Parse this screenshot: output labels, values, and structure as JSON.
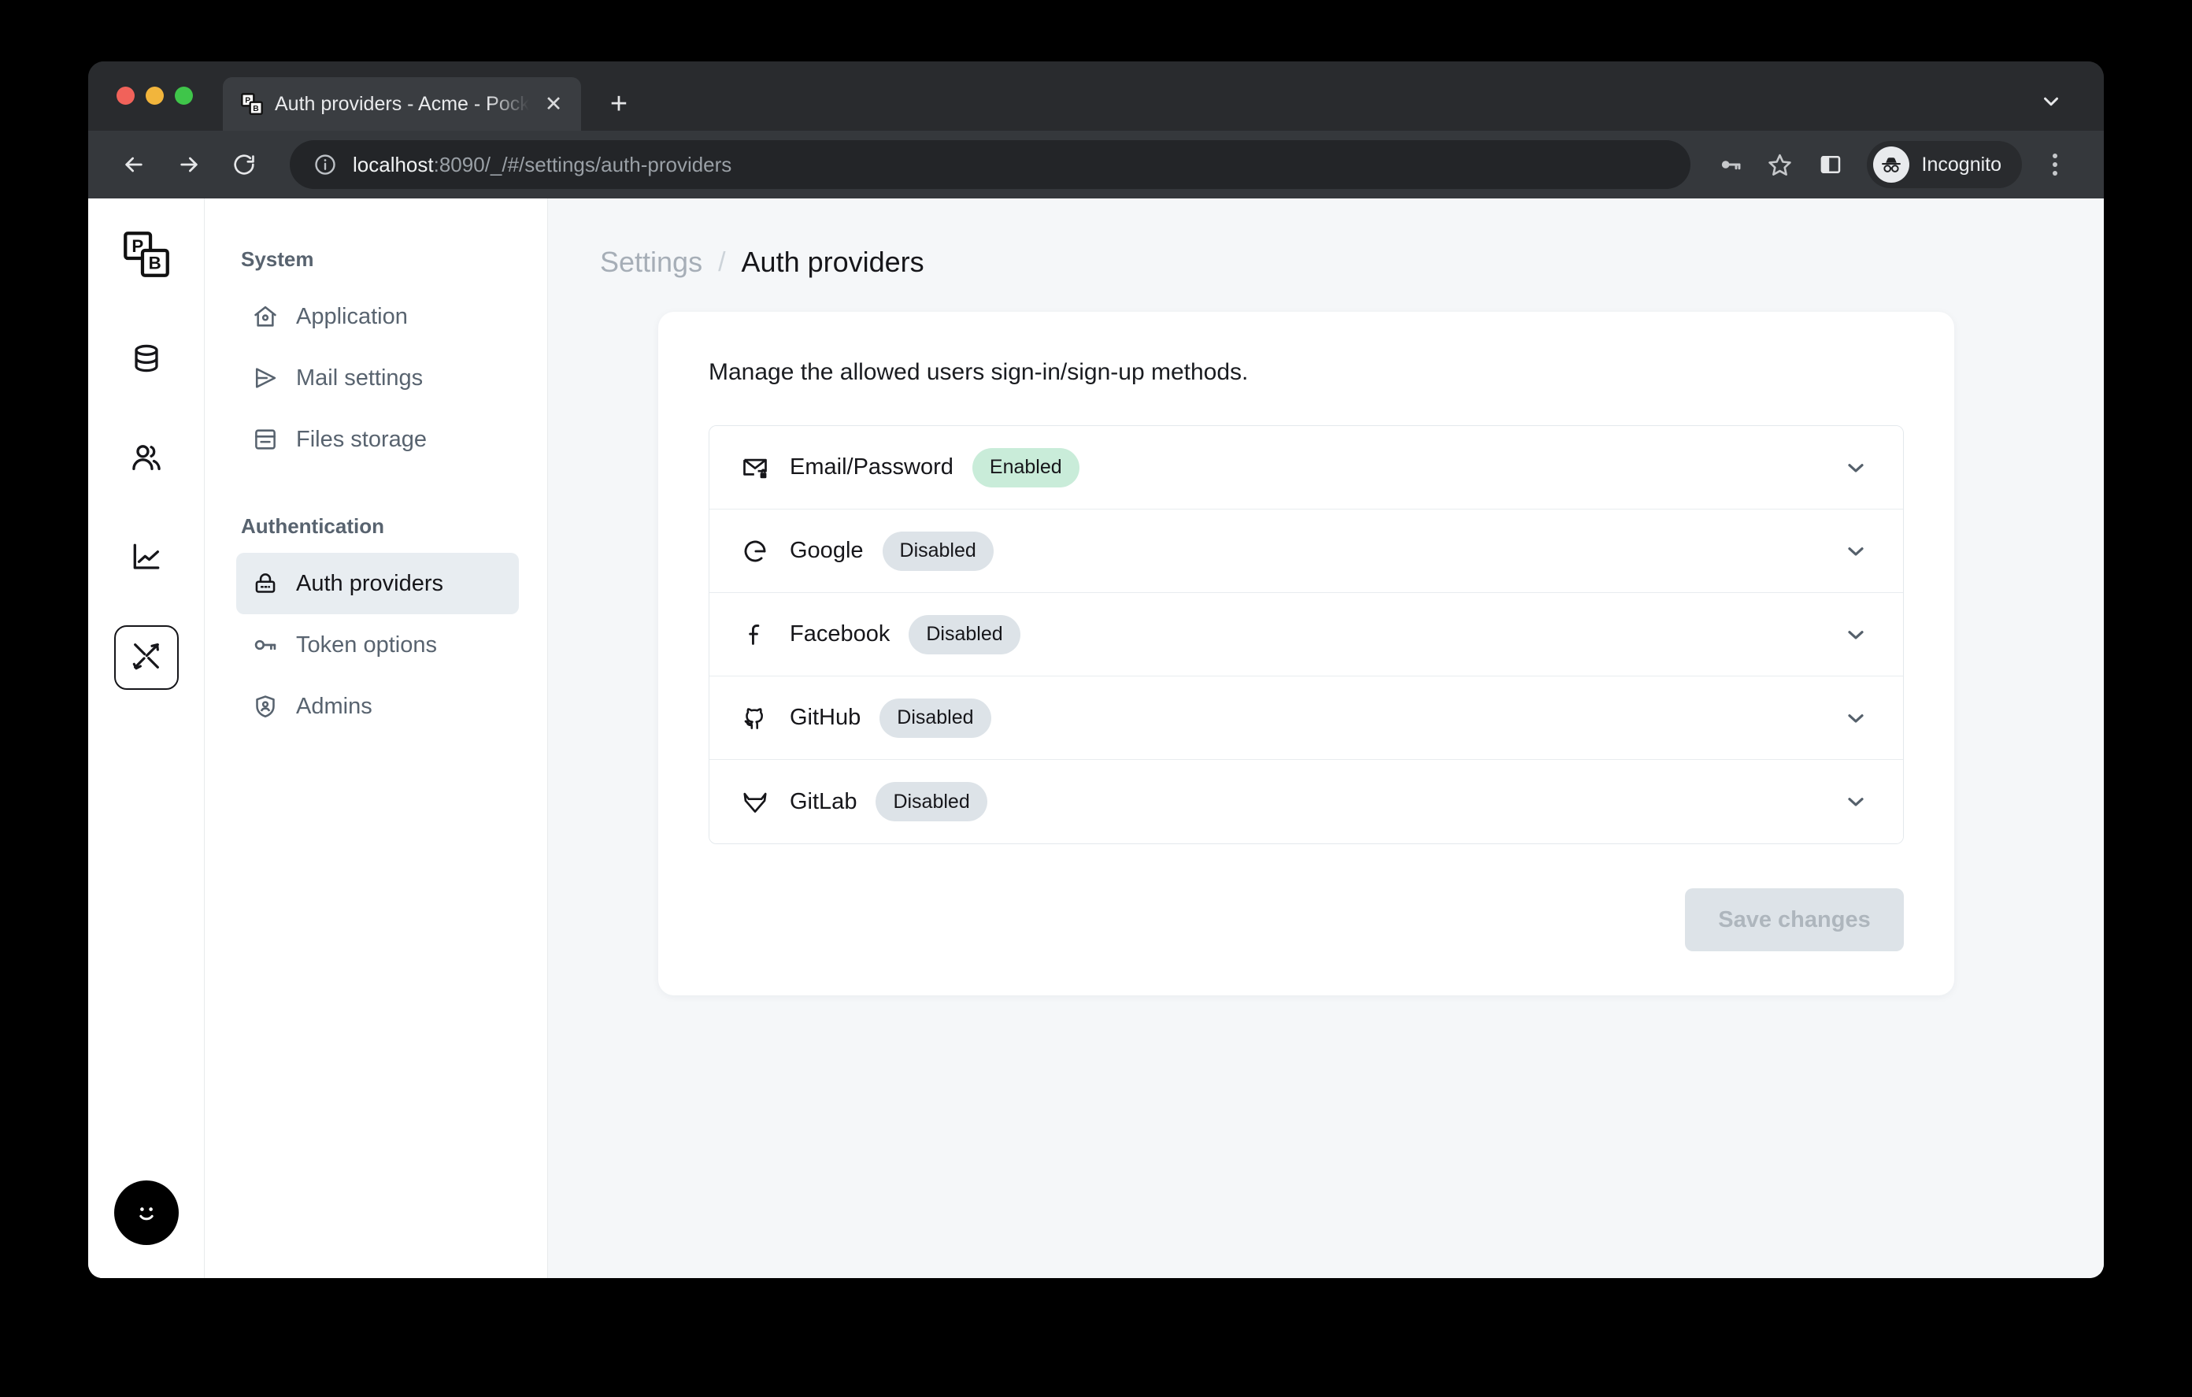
{
  "browser": {
    "tab": {
      "title": "Auth providers - Acme - Pocket",
      "favicon_name": "pocketbase-favicon",
      "close_label": "✕"
    },
    "new_tab_label": "+",
    "window_collapse_name": "chevron-down-icon",
    "toolbar": {
      "back_name": "back-arrow-icon",
      "forward_name": "forward-arrow-icon",
      "reload_name": "reload-icon",
      "site_info_name": "info-circle-icon",
      "url_host": "localhost",
      "url_rest": ":8090/_/#/settings/auth-providers",
      "password_key_name": "key-icon",
      "bookmark_name": "star-icon",
      "side_panel_name": "side-panel-icon",
      "profile_label": "Incognito",
      "menu_name": "kebab-menu-icon"
    }
  },
  "rail": {
    "logo_name": "pocketbase-logo",
    "items": [
      {
        "name": "collections",
        "icon": "database-icon",
        "active": false
      },
      {
        "name": "users",
        "icon": "users-icon",
        "active": false
      },
      {
        "name": "logs",
        "icon": "chart-line-icon",
        "active": false
      },
      {
        "name": "settings",
        "icon": "tools-icon",
        "active": true
      }
    ],
    "avatar_name": "smiley-avatar"
  },
  "sidebar": {
    "groups": [
      {
        "title": "System",
        "items": [
          {
            "label": "Application",
            "icon": "home-gear-icon",
            "active": false
          },
          {
            "label": "Mail settings",
            "icon": "paper-plane-icon",
            "active": false
          },
          {
            "label": "Files storage",
            "icon": "archive-icon",
            "active": false
          }
        ]
      },
      {
        "title": "Authentication",
        "items": [
          {
            "label": "Auth providers",
            "icon": "lock-icon",
            "active": true
          },
          {
            "label": "Token options",
            "icon": "key-icon",
            "active": false
          },
          {
            "label": "Admins",
            "icon": "shield-user-icon",
            "active": false
          }
        ]
      }
    ]
  },
  "breadcrumb": {
    "parent": "Settings",
    "separator": "/",
    "current": "Auth providers"
  },
  "card": {
    "description": "Manage the allowed users sign-in/sign-up methods.",
    "providers": [
      {
        "name": "Email/Password",
        "icon": "envelope-lock-icon",
        "status": "Enabled",
        "state": "enabled"
      },
      {
        "name": "Google",
        "icon": "google-icon",
        "status": "Disabled",
        "state": "disabled"
      },
      {
        "name": "Facebook",
        "icon": "facebook-icon",
        "status": "Disabled",
        "state": "disabled"
      },
      {
        "name": "GitHub",
        "icon": "github-icon",
        "status": "Disabled",
        "state": "disabled"
      },
      {
        "name": "GitLab",
        "icon": "gitlab-icon",
        "status": "Disabled",
        "state": "disabled"
      }
    ],
    "save_label": "Save changes"
  },
  "colors": {
    "enabled_badge_bg": "#c9ecd9",
    "disabled_badge_bg": "#dde3e8",
    "page_bg": "#f5f7f9",
    "accent_text": "#58636f"
  }
}
